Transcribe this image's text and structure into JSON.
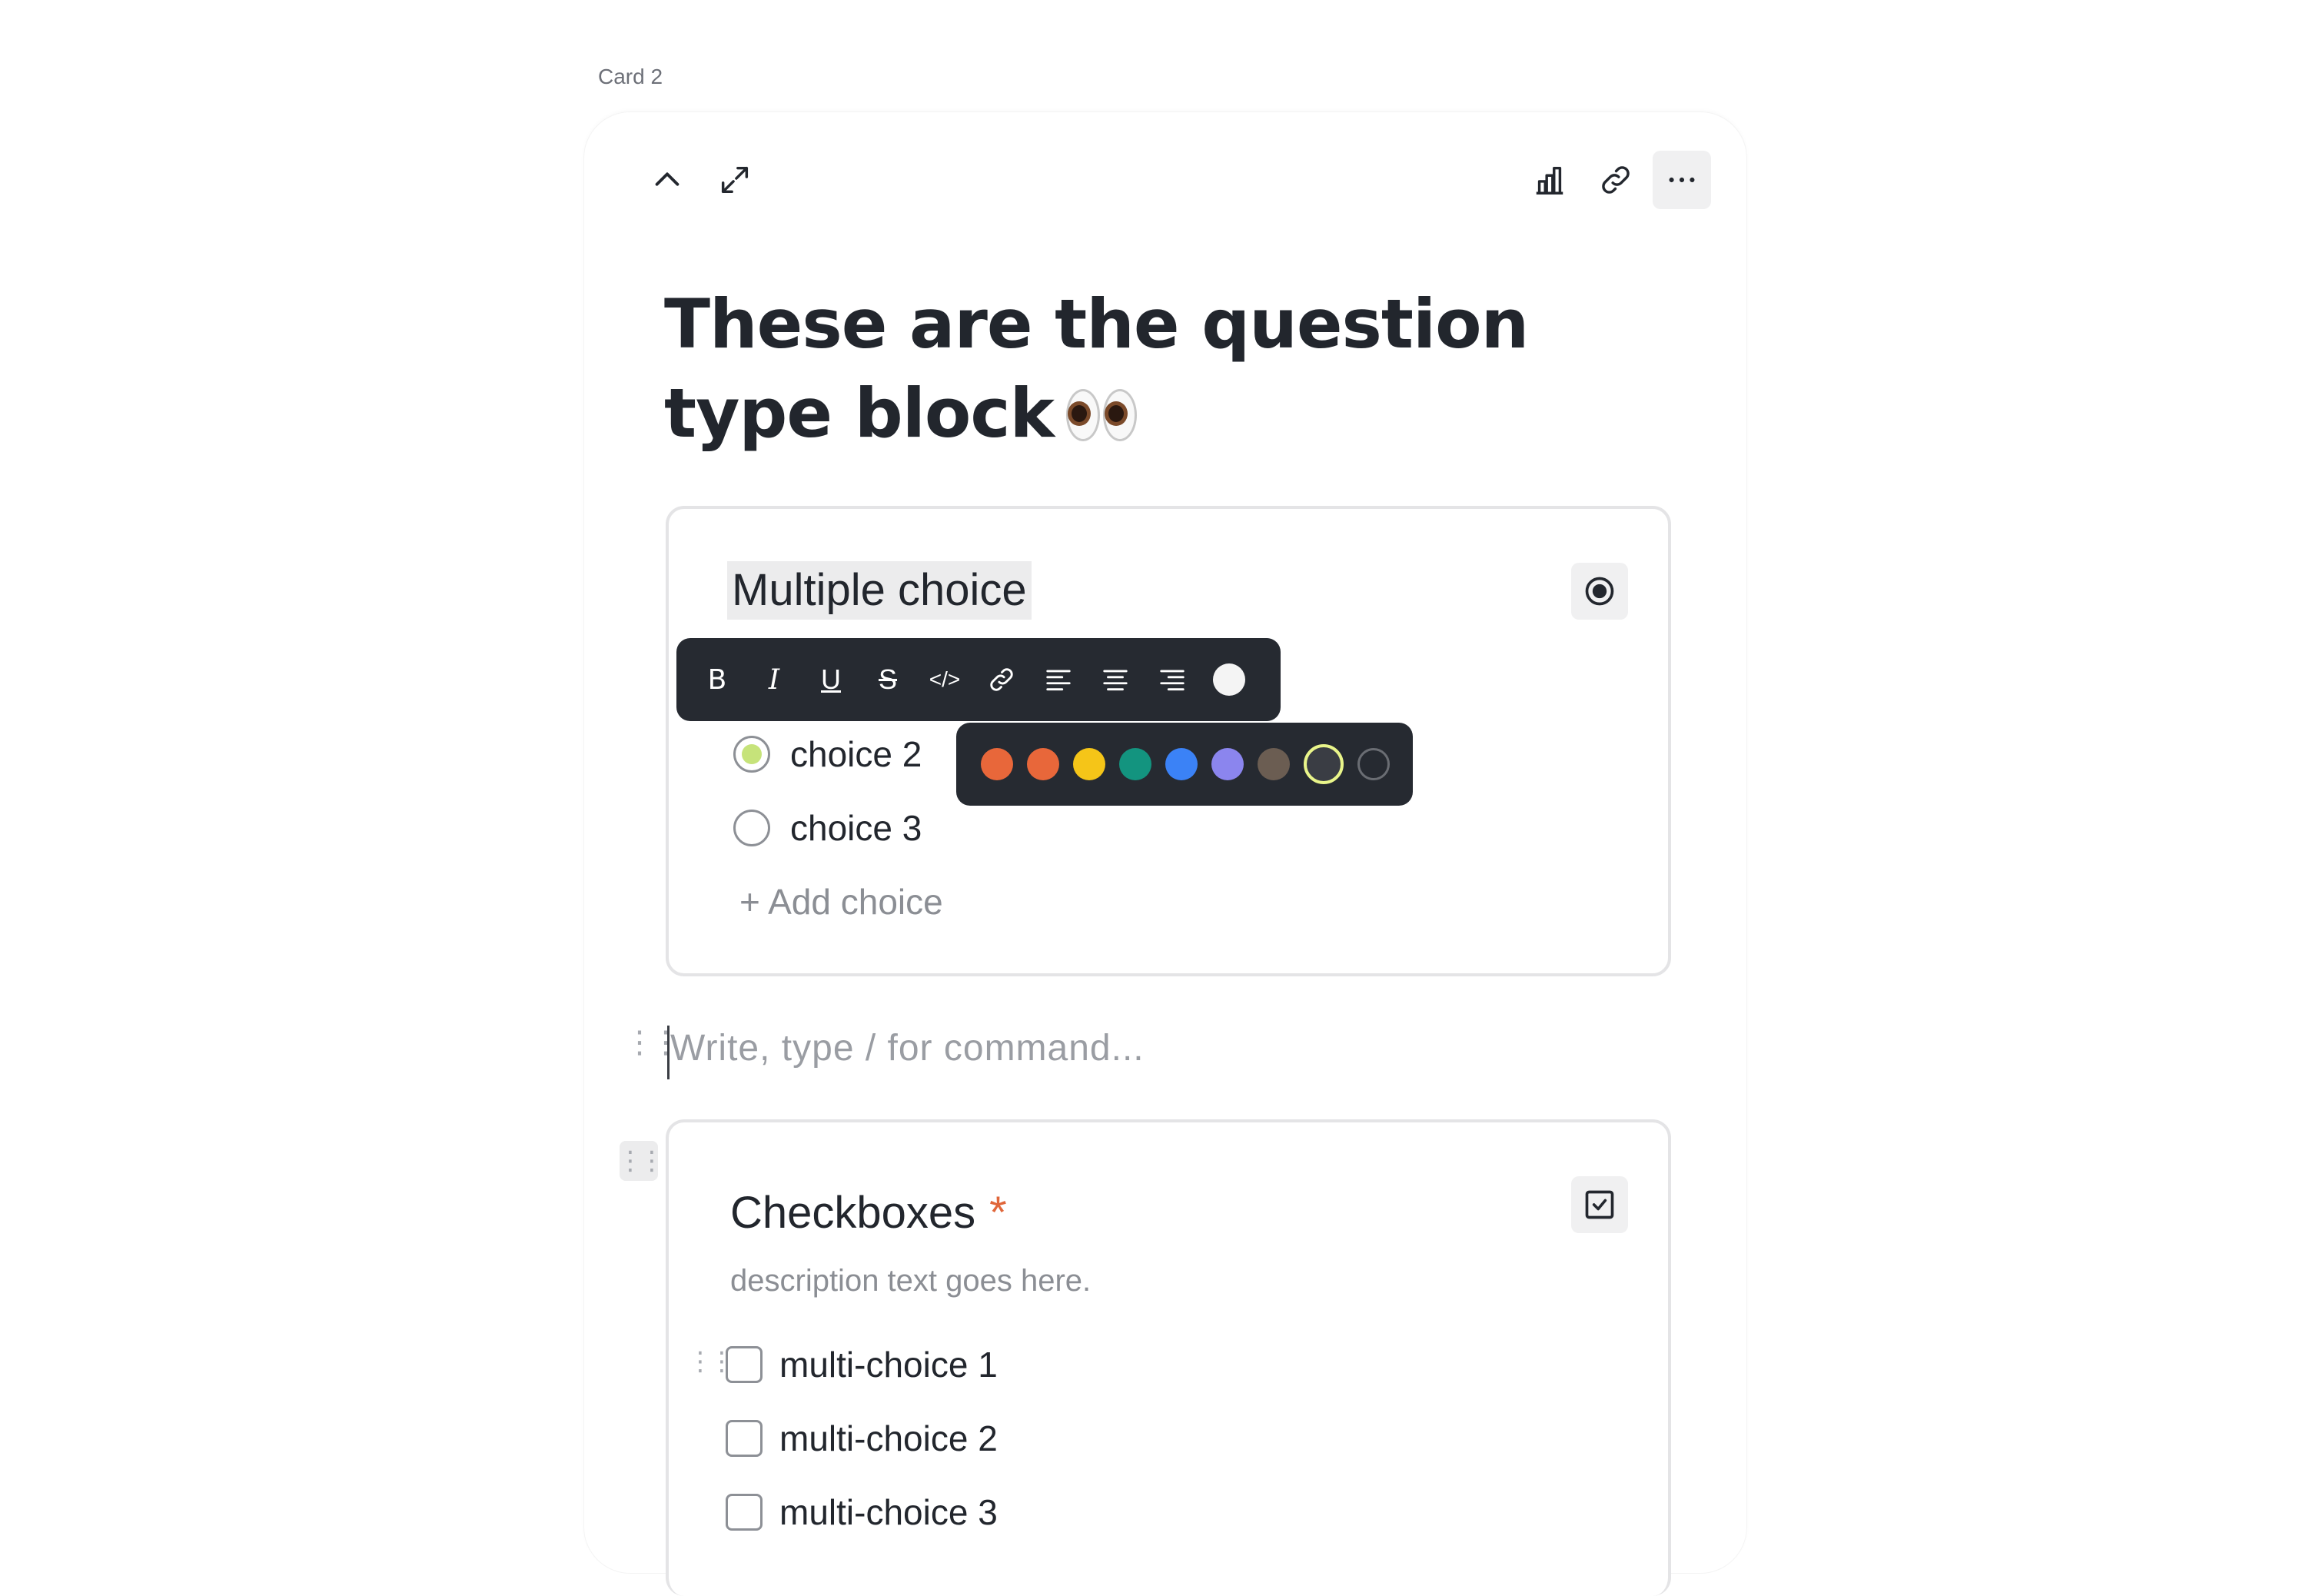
{
  "card_label": "Card 2",
  "top_icons": {
    "collapse": "chevron-up-icon",
    "expand": "expand-icon",
    "stats": "bar-chart-icon",
    "link": "link-icon",
    "more": "more-horizontal-icon"
  },
  "page": {
    "title": "These are the question type block",
    "title_emoji": "eyes-emoji"
  },
  "multiple_choice": {
    "title": "Multiple choice",
    "type_icon": "radio-icon",
    "choices": [
      {
        "label": "choice 2",
        "selected": true
      },
      {
        "label": "choice 3",
        "selected": false
      }
    ],
    "add_choice": "+ Add choice"
  },
  "format_toolbar": {
    "buttons": [
      "bold",
      "italic",
      "underline",
      "strikethrough",
      "code",
      "link",
      "align-left",
      "align-center",
      "align-right",
      "text-color"
    ],
    "bold_glyph": "B",
    "italic_glyph": "I",
    "underline_glyph": "U",
    "strike_glyph": "S",
    "code_glyph": "</>"
  },
  "color_palette": [
    "#e8673a",
    "#e8673a",
    "#f5c518",
    "#13947f",
    "#3b82f6",
    "#8b85ee",
    "#6b5d52",
    "#3a3d44",
    "#262a31"
  ],
  "color_palette_selected_index": 7,
  "editor": {
    "placeholder": "Write, type / for command..."
  },
  "checkboxes": {
    "title": "Checkboxes",
    "required_mark": "*",
    "description": "description text goes here.",
    "type_icon": "checkbox-icon",
    "items": [
      "multi-choice 1",
      "multi-choice 2",
      "multi-choice 3"
    ]
  }
}
